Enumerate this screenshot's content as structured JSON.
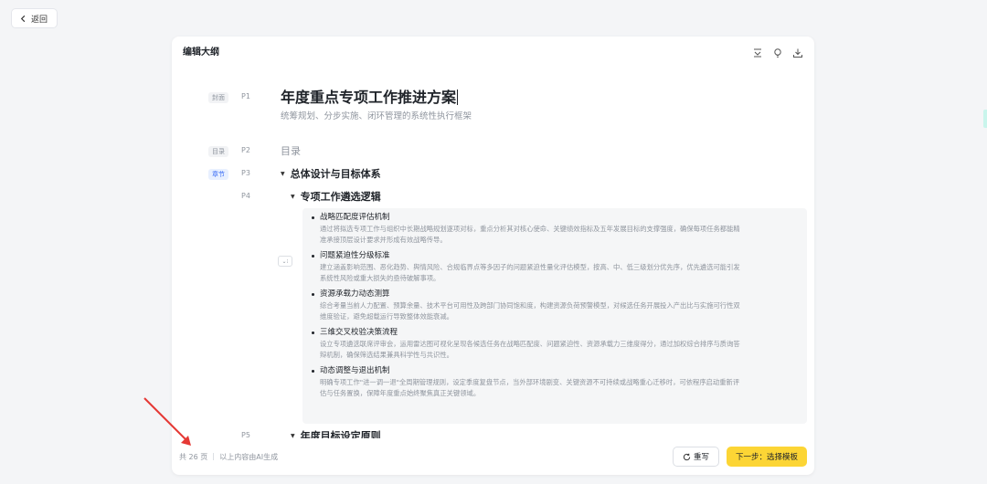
{
  "nav": {
    "back_label": "返回"
  },
  "panel": {
    "title": "编辑大纲"
  },
  "outline": {
    "cover_tag": "封面",
    "toc_tag": "目录",
    "chapter_tag": "章节",
    "pages": {
      "p1": "P1",
      "p2": "P2",
      "p3": "P3",
      "p4": "P4",
      "p5": "P5"
    },
    "title": "年度重点专项工作推进方案",
    "subtitle": "统筹规划、分步实施、闭环管理的系统性执行框架",
    "toc_label": "目录",
    "chapter1": "总体设计与目标体系",
    "section1": "专项工作遴选逻辑",
    "bullets": [
      {
        "title": "战略匹配度评估机制",
        "desc1": "通过将拟选专项工作与组织中长期战略规划逐项对标，重点分析其对核心使命、关键绩效指标及五年发展目标的支撑强度，确保每项任务都能精",
        "desc2": "准承接顶层设计要求并形成有效战略传导。"
      },
      {
        "title": "问题紧迫性分级标准",
        "desc1": "建立涵盖影响范围、恶化趋势、舆情风险、合规临界点等多因子的问题紧迫性量化评估模型，按高、中、低三级划分优先序，优先遴选可能引发",
        "desc2": "系统性风险或重大损失的亟待破解事项。"
      },
      {
        "title": "资源承载力动态测算",
        "desc1": "综合考量当前人力配置、预算余量、技术平台可用性及跨部门协同饱和度，构建资源负荷预警模型，对候选任务开展投入产出比与实施可行性双",
        "desc2": "维度验证，避免超载运行导致整体效能衰减。"
      },
      {
        "title": "三维交叉校验决策流程",
        "desc1": "设立专项遴选联席评审会，运用雷达图可视化呈现各候选任务在战略匹配度、问题紧迫性、资源承载力三维度得分，通过加权综合排序与质询答",
        "desc2": "辩机制，确保筛选结果兼具科学性与共识性。"
      },
      {
        "title": "动态调整与退出机制",
        "desc1": "明确专项工作\"进一调一退\"全周期管理规则，设定季度复盘节点，当外部环境剧变、关键资源不可持续或战略重心迁移时，可依程序启动重新评",
        "desc2": "估与任务置换，保障年度重点始终聚焦真正关键领域。"
      }
    ],
    "section2": "年度目标设定原则"
  },
  "footer": {
    "page_count": "共 26 页",
    "ai_note": "以上内容由AI生成",
    "rewrite_label": "重写",
    "next_label": "下一步：选择模板"
  },
  "colors": {
    "accent": "#fcd535",
    "chapter_tag": "#3b6ef5",
    "arrow": "#e53935"
  }
}
